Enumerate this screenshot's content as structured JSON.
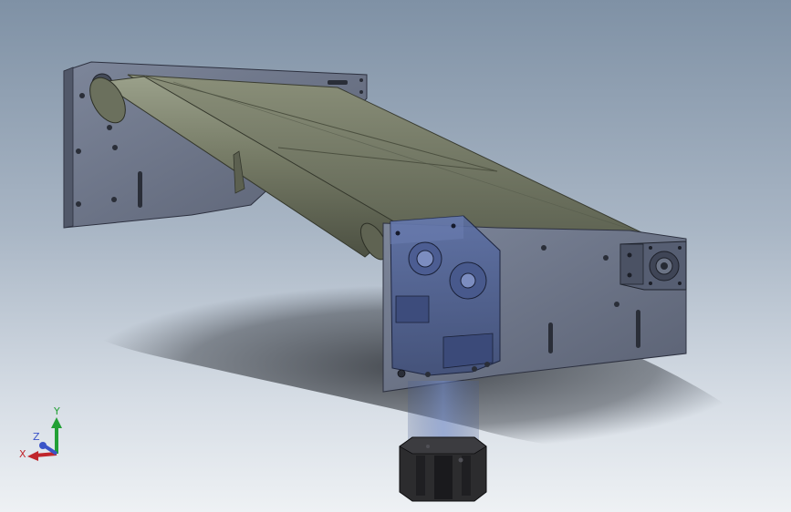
{
  "viewport": {
    "background_top": "#7f91a5",
    "background_bottom": "#eef1f4"
  },
  "model": {
    "description_icon": "belt-conveyor-assembly-icon",
    "frame_color": "#6f778a",
    "belt_color": "#7a7f6c",
    "housing_color": "#5a6a9a",
    "motor_color": "#2d2d2d"
  },
  "triad": {
    "x_label": "X",
    "y_label": "Y",
    "z_label": "Z",
    "x_color": "#c0262c",
    "y_color": "#22a035",
    "z_color": "#3b54c8"
  }
}
